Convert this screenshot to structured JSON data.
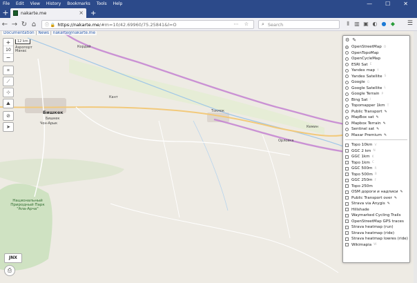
{
  "menubar": {
    "items": [
      "File",
      "Edit",
      "View",
      "History",
      "Bookmarks",
      "Tools",
      "Help"
    ]
  },
  "tab": {
    "title": "nakarte.me",
    "close": "×",
    "new_tab": "+"
  },
  "window": {
    "minimize": "—",
    "maximize": "☐",
    "close": "✕"
  },
  "nav": {
    "url_domain": "https://nakarte.me",
    "url_rest": "/#m=10/42.69960/75.25841&l=O",
    "search_placeholder": "Search"
  },
  "map": {
    "links": {
      "documentation": "Documentation",
      "news": "News",
      "email": "nakarte@nakarte.me"
    },
    "scale": "12 km",
    "zoom_in": "+",
    "zoom_level": "10",
    "zoom_out": "−",
    "jnx_label": "JNX",
    "labels": {
      "korday": "Кордай",
      "bishkek": "Бишкек",
      "bishkek_sub": "Бишкек",
      "airport": "Аэропорт Манас",
      "kant": "Кант",
      "tokmok": "Токмок",
      "kemin": "Кемин",
      "orlovka": "Орловка",
      "chui": "Чон-Арык",
      "park": "Национальный Природный Парк \"Ала-Арча\""
    }
  },
  "layers": {
    "base": [
      {
        "name": "OpenStreetMap",
        "hotkey": "O",
        "selected": true
      },
      {
        "name": "OpenTopoMap",
        "hotkey": ""
      },
      {
        "name": "OpenCycleMap",
        "hotkey": ""
      },
      {
        "name": "ESRI Sat",
        "hotkey": "E"
      },
      {
        "name": "Yandex map",
        "hotkey": "Y"
      },
      {
        "name": "Yandex Satellite",
        "hotkey": "S"
      },
      {
        "name": "Google",
        "hotkey": "G"
      },
      {
        "name": "Google Satellite",
        "hotkey": "L"
      },
      {
        "name": "Google Terrain",
        "hotkey": "P"
      },
      {
        "name": "Bing Sat",
        "hotkey": "I"
      },
      {
        "name": "Topomapper 1km",
        "hotkey": "T"
      },
      {
        "name": "Public Transport",
        "hotkey": "",
        "pen": true
      },
      {
        "name": "MapBox sat",
        "hotkey": "",
        "pen": true
      },
      {
        "name": "Mapbox Terrain",
        "hotkey": "",
        "pen": true
      },
      {
        "name": "Sentinel sat",
        "hotkey": "",
        "pen": true
      },
      {
        "name": "Maxar Premium",
        "hotkey": "",
        "pen": true
      }
    ],
    "overlays": [
      {
        "name": "Topo 10km",
        "hotkey": "V"
      },
      {
        "name": "GGC 2 km",
        "hotkey": "N"
      },
      {
        "name": "GGC 1km",
        "hotkey": "K"
      },
      {
        "name": "Topo 1km",
        "hotkey": "C"
      },
      {
        "name": "GGC 500m",
        "hotkey": "R"
      },
      {
        "name": "Topo 500m",
        "hotkey": "B"
      },
      {
        "name": "GGC 250m",
        "hotkey": "F"
      },
      {
        "name": "Topo 250m",
        "hotkey": ""
      },
      {
        "name": "OSM дороги и надписи",
        "hotkey": "",
        "pen": true
      },
      {
        "name": "Public Transport over",
        "hotkey": "",
        "pen": true
      },
      {
        "name": "Strava via Anygis",
        "hotkey": "",
        "pen": true
      },
      {
        "name": "Hillshade",
        "hotkey": "",
        "pen": false
      },
      {
        "name": "Waymarked Cycling Trails",
        "hotkey": ""
      },
      {
        "name": "OpenStreetMap GPS traces",
        "hotkey": ""
      },
      {
        "name": "Strava heatmap (run)",
        "hotkey": ""
      },
      {
        "name": "Strava heatmap (ride)",
        "hotkey": ""
      },
      {
        "name": "Strava heatmap lowres (ride)",
        "hotkey": ""
      },
      {
        "name": "Wikimapia",
        "hotkey": "W"
      }
    ]
  }
}
